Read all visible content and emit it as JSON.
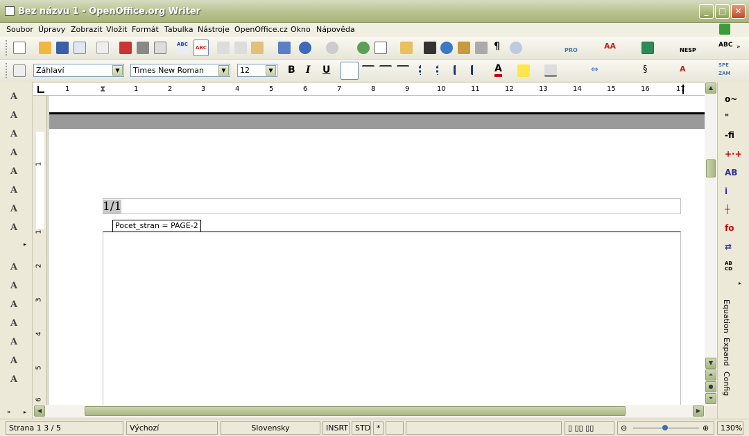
{
  "window": {
    "title": "Bez názvu 1 - OpenOffice.org Writer"
  },
  "menu": [
    "Soubor",
    "Úpravy",
    "Zobrazit",
    "Vložit",
    "Formát",
    "Tabulka",
    "Nástroje",
    "OpenOffice.cz",
    "Okno",
    "Nápověda"
  ],
  "format_bar": {
    "style": "Záhlaví",
    "font": "Times New Roman",
    "size": "12",
    "bold": "B",
    "italic": "I",
    "underline": "U"
  },
  "toolbar_labels": {
    "pro": "PRO",
    "nesp": "NESP",
    "spe": "SPE",
    "zam": "ZAM"
  },
  "ruler": {
    "h": [
      "1",
      "1",
      "2",
      "3",
      "4",
      "5",
      "6",
      "7",
      "8",
      "9",
      "10",
      "11",
      "12",
      "13",
      "14",
      "15",
      "16",
      "17"
    ],
    "v": [
      "1",
      "1",
      "2",
      "3",
      "4",
      "5",
      "6"
    ]
  },
  "document": {
    "page_number_field": "1/1",
    "tooltip": "Pocet_stran = PAGE-2"
  },
  "right_panel": {
    "equation": "Equation",
    "expand": "Expand",
    "config": "Config"
  },
  "status": {
    "page": "Strana 1   3 / 5",
    "style": "Výchozí",
    "language": "Slovensky",
    "insert": "INSRT",
    "selection": "STD",
    "modified": "*",
    "zoom": "130%"
  }
}
